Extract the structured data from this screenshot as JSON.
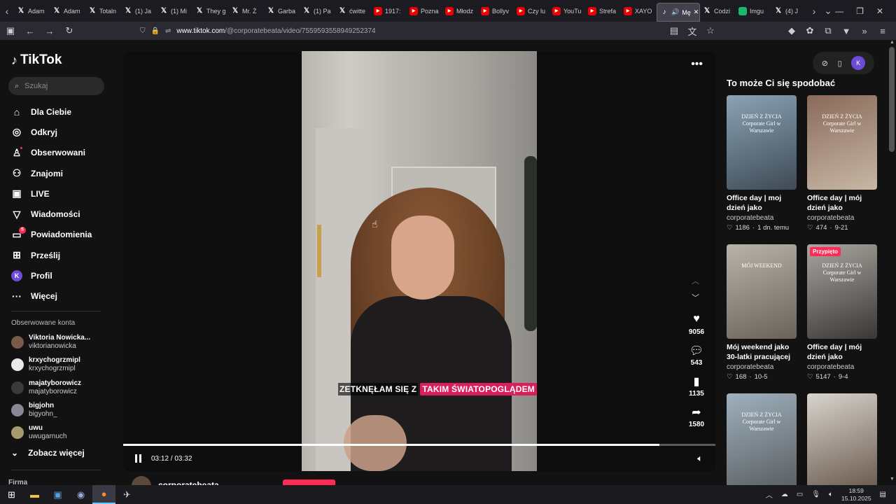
{
  "browser": {
    "tabs": [
      {
        "icon": "x-icon",
        "label": "Adam"
      },
      {
        "icon": "x-icon",
        "label": "Adam"
      },
      {
        "icon": "x-icon",
        "label": "Totaln"
      },
      {
        "icon": "x-icon",
        "label": "(1) Ja"
      },
      {
        "icon": "x-icon",
        "label": "(1) Mi"
      },
      {
        "icon": "x-icon",
        "label": "They g"
      },
      {
        "icon": "x-icon",
        "label": "Mr. Ż"
      },
      {
        "icon": "x-icon",
        "label": "Garba"
      },
      {
        "icon": "x-icon",
        "label": "(1) Pa"
      },
      {
        "icon": "x-icon",
        "label": "ćwitte"
      },
      {
        "icon": "youtube-icon",
        "label": "1917:"
      },
      {
        "icon": "youtube-icon",
        "label": "Pozna"
      },
      {
        "icon": "youtube-icon",
        "label": "Młodz"
      },
      {
        "icon": "youtube-icon",
        "label": "Bollyv"
      },
      {
        "icon": "youtube-icon",
        "label": "Czy lu"
      },
      {
        "icon": "youtube-icon",
        "label": "YouTu"
      },
      {
        "icon": "youtube-icon",
        "label": "Strefa"
      },
      {
        "icon": "youtube-icon",
        "label": "XAYO"
      }
    ],
    "active_tab": {
      "label": "Mę"
    },
    "tabs_after": [
      {
        "icon": "x-icon",
        "label": "Codzi"
      },
      {
        "icon": "imgur-icon",
        "label": "Imgu"
      },
      {
        "icon": "x-icon",
        "label": "(4) J"
      }
    ],
    "url_host": "www.tiktok.com",
    "url_path": "/@corporatebeata/video/7559593558949252374"
  },
  "sidebar": {
    "logo": "TikTok",
    "search_placeholder": "Szukaj",
    "nav": [
      {
        "icon": "home-icon",
        "glyph": "⌂",
        "label": "Dla Ciebie"
      },
      {
        "icon": "compass-icon",
        "glyph": "◎",
        "label": "Odkryj"
      },
      {
        "icon": "following-icon",
        "glyph": "♙",
        "label": "Obserwowani"
      },
      {
        "icon": "friends-icon",
        "glyph": "⚇",
        "label": "Znajomi"
      },
      {
        "icon": "live-icon",
        "glyph": "▣",
        "label": "LIVE"
      },
      {
        "icon": "messages-icon",
        "glyph": "▽",
        "label": "Wiadomości"
      },
      {
        "icon": "notifications-icon",
        "glyph": "▭",
        "label": "Powiadomienia"
      },
      {
        "icon": "upload-icon",
        "glyph": "⊞",
        "label": "Prześlij"
      },
      {
        "icon": "profile-icon",
        "glyph": "K",
        "label": "Profil"
      },
      {
        "icon": "more-icon",
        "glyph": "···",
        "label": "Więcej"
      }
    ],
    "notifications_badge": "5",
    "followed_title": "Obserwowane konta",
    "followed": [
      {
        "name": "Viktoria Nowicka...",
        "handle": "viktorianowicka",
        "color": "#7a5a4a"
      },
      {
        "name": "krxychogrzmipl",
        "handle": "krxychogrzmipl",
        "color": "#e8e8e8"
      },
      {
        "name": "majatyborowicz",
        "handle": "majatyborowicz",
        "color": "#3a3a3a"
      },
      {
        "name": "bigjohn",
        "handle": "bigyohn_",
        "color": "#888899"
      },
      {
        "name": "uwu",
        "handle": "uwugarnuch",
        "color": "#a89a70"
      }
    ],
    "see_more": "Zobacz więcej",
    "company": "Firma"
  },
  "player": {
    "caption_plain": "ZETKNĘŁAM SIĘ Z",
    "caption_highlight": "TAKIM ŚWIATOPOGLĄDEM",
    "time": "03:12 / 03:32",
    "progress": 0.905,
    "likes": "9056",
    "comments": "543",
    "saves": "1135",
    "shares": "1580",
    "author": "corporatebeata"
  },
  "recommendations": {
    "title": "To może Ci się spodobać",
    "items": [
      {
        "thumb_text": "DZIEŃ Z ŻYCIA Corporate Girl w Warszawie",
        "pinned": "",
        "title": "Office day | moj dzień jako analytic...",
        "author": "corporatebeata",
        "likes": "1186",
        "date": "1 dn. temu",
        "bg": "linear-gradient(160deg,#8aa3b5,#3e4a55)"
      },
      {
        "thumb_text": "DZIEŃ Z ŻYCIA Corporate Girl w Warszawie",
        "pinned": "",
        "title": "Office day | mój dzień jako analytic...",
        "author": "corporatebeata",
        "likes": "474",
        "date": "9-21",
        "bg": "linear-gradient(160deg,#8a6a5a,#c7b7a5)"
      },
      {
        "thumb_text": "MÓJ WEEKEND",
        "pinned": "",
        "title": "Mój weekend jako 30-latki pracującej ...",
        "author": "corporatebeata",
        "likes": "168",
        "date": "10-5",
        "bg": "linear-gradient(160deg,#b9b3aa,#6a625a)"
      },
      {
        "thumb_text": "DZIEŃ Z ŻYCIA Corporate Girl w Warszawie",
        "pinned": "Przypięto",
        "title": "Office day | mój dzień jako analytic...",
        "author": "corporatebeata",
        "likes": "5147",
        "date": "9-4",
        "bg": "linear-gradient(160deg,#a9a5a0,#3a3634)"
      },
      {
        "thumb_text": "DZIEŃ Z ŻYCIA Corporate Girl w Warszawie",
        "pinned": "",
        "title": "",
        "author": "",
        "likes": "",
        "date": "",
        "bg": "linear-gradient(160deg,#9fb0bd,#5a5f62)"
      },
      {
        "thumb_text": "",
        "pinned": "",
        "title": "",
        "author": "",
        "likes": "",
        "date": "",
        "bg": "linear-gradient(160deg,#d8d4cc,#6b5a50)"
      }
    ]
  },
  "taskbar": {
    "time": "18:59",
    "date": "15.10.2025"
  }
}
